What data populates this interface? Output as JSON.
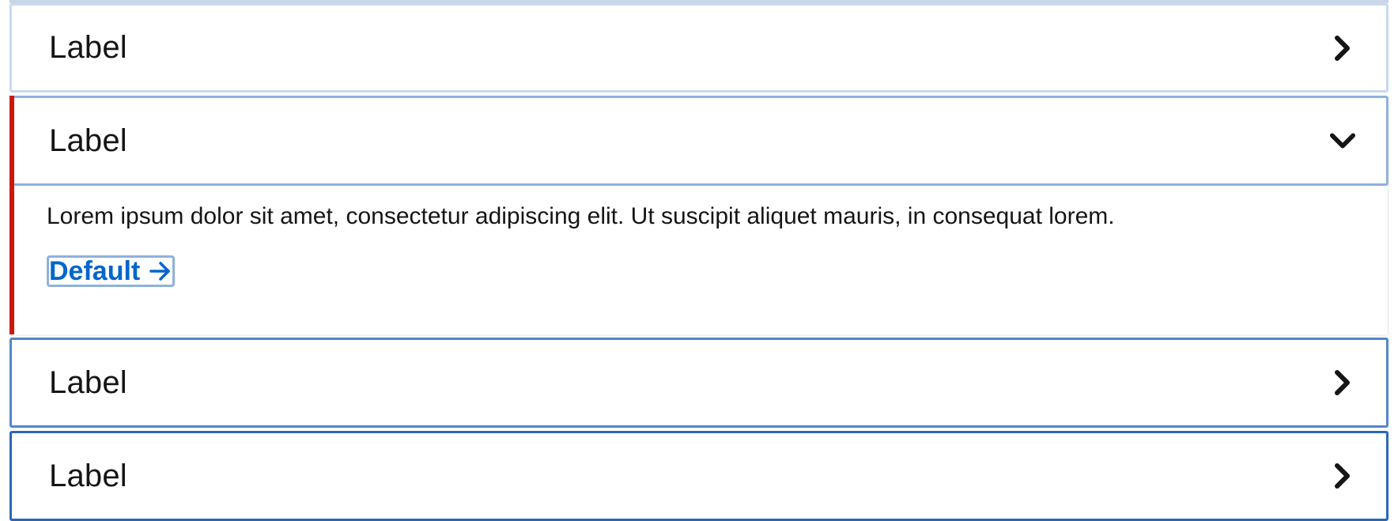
{
  "accordion": {
    "items": [
      {
        "label": "Label",
        "expanded": false,
        "chevron": "chevron-right-icon"
      },
      {
        "label": "Label",
        "expanded": true,
        "chevron": "chevron-down-icon",
        "body_text": "Lorem ipsum dolor sit amet, consectetur adipiscing elit. Ut suscipit aliquet mauris, in consequat lorem.",
        "link_label": "Default",
        "link_icon": "arrow-right-icon"
      },
      {
        "label": "Label",
        "expanded": false,
        "chevron": "chevron-right-icon"
      },
      {
        "label": "Label",
        "expanded": false,
        "chevron": "chevron-right-icon"
      }
    ]
  },
  "colors": {
    "danger_accent": "#c9190b",
    "link": "#0066cc",
    "text": "#151515"
  }
}
